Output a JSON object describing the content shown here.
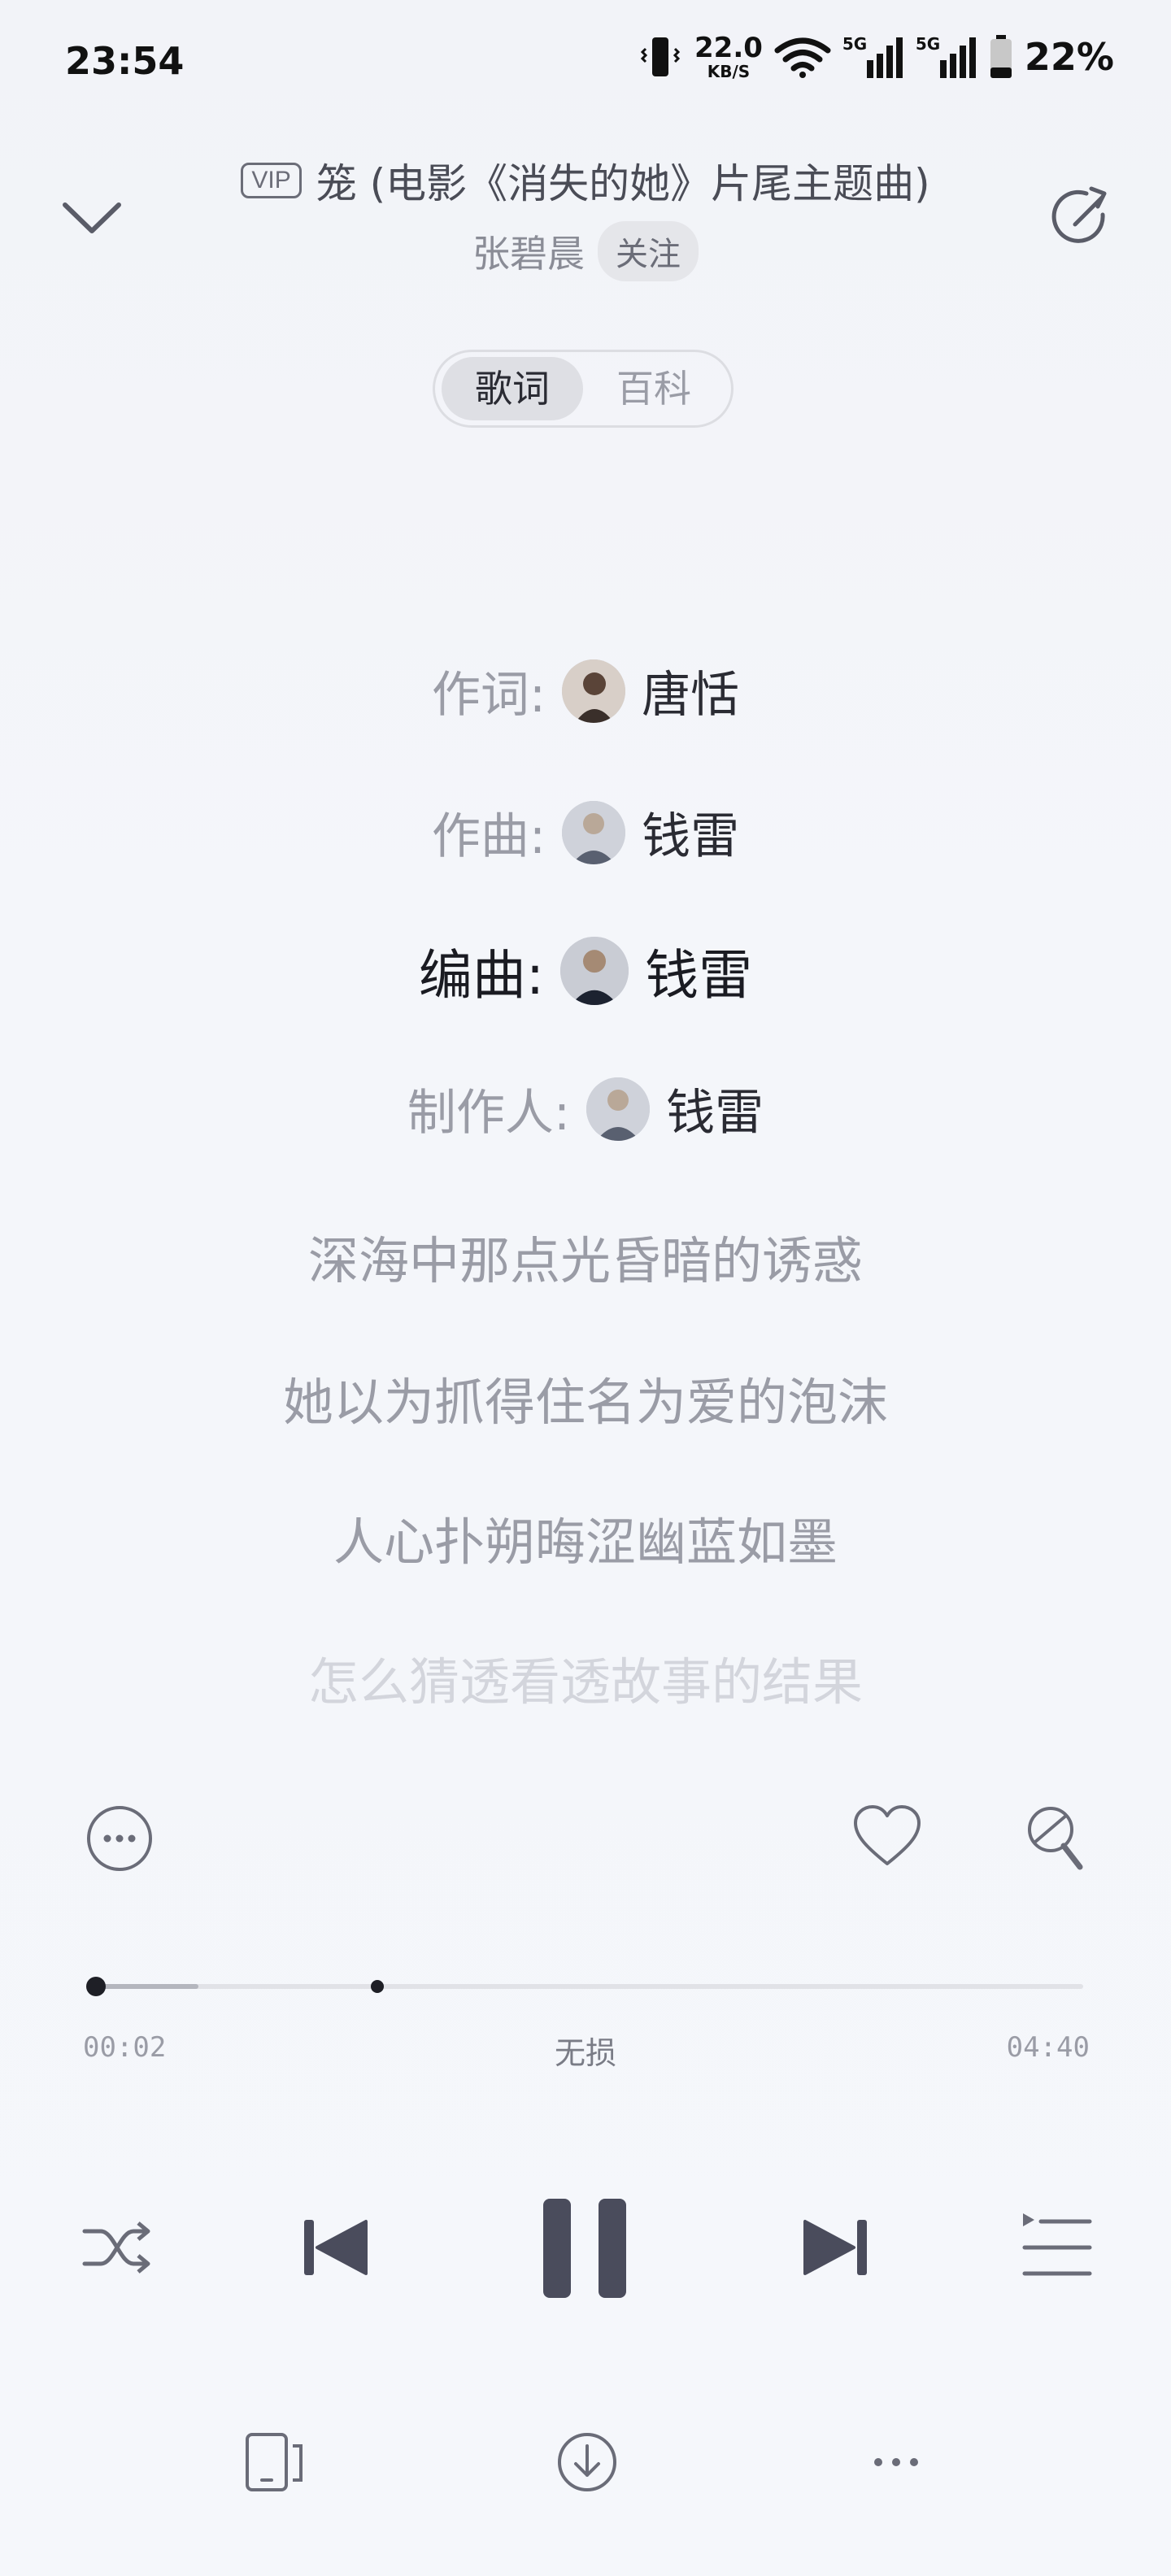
{
  "status_bar": {
    "time": "23:54",
    "net_speed_value": "22.0",
    "net_speed_unit": "KB/S",
    "net1": "5G",
    "net2": "5G",
    "battery": "22%"
  },
  "header": {
    "vip_badge": "VIP",
    "title": "笼 (电影《消失的她》片尾主题曲)",
    "artist": "张碧晨",
    "follow_label": "关注"
  },
  "tabs": [
    {
      "label": "歌词",
      "active": true
    },
    {
      "label": "百科",
      "active": false
    }
  ],
  "credits": [
    {
      "role": "作词:",
      "name": "唐恬"
    },
    {
      "role": "作曲:",
      "name": "钱雷"
    },
    {
      "role": "编曲:",
      "name": "钱雷",
      "current": true
    },
    {
      "role": "制作人:",
      "name": "钱雷"
    }
  ],
  "lyrics": [
    "深海中那点光昏暗的诱惑",
    "她以为抓得住名为爱的泡沫",
    "人心扑朔晦涩幽蓝如墨",
    "怎么猜透看透故事的结果"
  ],
  "player": {
    "current_time": "00:02",
    "total_time": "04:40",
    "quality": "无损",
    "progress_fraction": 0.007
  },
  "icons": {
    "collapse": "chevron-down-icon",
    "share": "share-icon",
    "more": "more-circle-icon",
    "like": "heart-icon",
    "sing": "microphone-icon",
    "shuffle": "shuffle-icon",
    "prev": "previous-icon",
    "pause": "pause-icon",
    "next": "next-icon",
    "playlist": "playlist-icon",
    "device": "device-icon",
    "download": "download-icon",
    "more_h": "more-horizontal-icon"
  },
  "colors": {
    "background": "#f3f5f9",
    "primary_text": "#1a1b22",
    "secondary_text": "#9a9ca6",
    "control": "#4a4c5c"
  }
}
